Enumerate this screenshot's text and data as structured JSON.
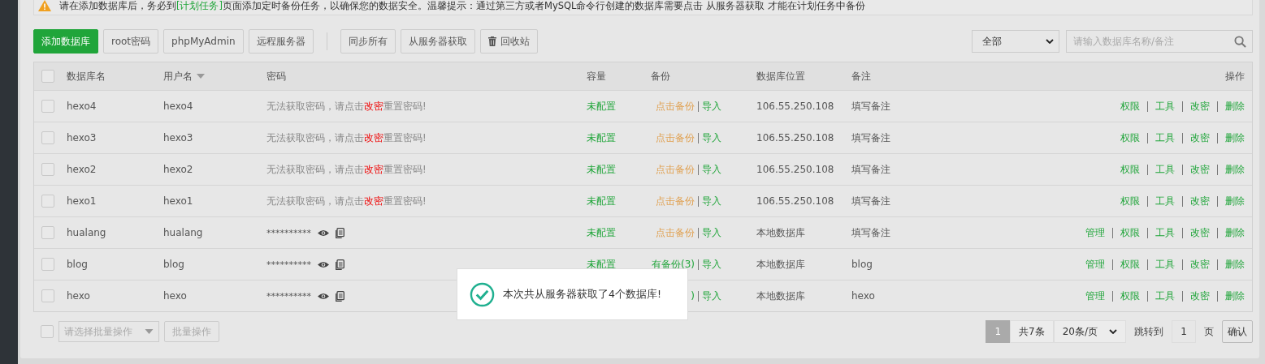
{
  "notice": {
    "before": "请在添加数据库后，务必到",
    "link": "[计划任务]",
    "after": "页面添加定时备份任务，以确保您的数据安全。温馨提示：通过第三方或者MySQL命令行创建的数据库需要点击 从服务器获取 才能在计划任务中备份"
  },
  "toolbar": {
    "buttons": [
      {
        "label": "添加数据库",
        "kind": "primary"
      },
      {
        "label": "root密码",
        "kind": "plain"
      },
      {
        "label": "phpMyAdmin",
        "kind": "plain"
      },
      {
        "label": "远程服务器",
        "kind": "plain"
      },
      {
        "label": "同步所有",
        "kind": "plain"
      },
      {
        "label": "从服务器获取",
        "kind": "plain"
      },
      {
        "label": "回收站",
        "kind": "trash"
      }
    ],
    "filter": {
      "value": "全部"
    },
    "search": {
      "placeholder": "请输入数据库名称/备注"
    }
  },
  "table": {
    "select_all": {
      "checked": false
    },
    "columns": [
      {
        "label": "数据库名",
        "sortable": false
      },
      {
        "label": "用户名",
        "sortable": true
      },
      {
        "label": "密码",
        "sortable": false
      },
      {
        "label": "容量",
        "sortable": false
      },
      {
        "label": "备份",
        "sortable": false
      },
      {
        "label": "数据库位置",
        "sortable": false
      },
      {
        "label": "备注",
        "sortable": false
      },
      {
        "label": "操作",
        "sortable": false
      }
    ],
    "rows": [
      {
        "checked": false,
        "name": "hexo4",
        "user": "hexo4",
        "password": {
          "kind": "hint",
          "before": "无法获取密码，请点击",
          "link": "改密",
          "after": "重置密码!"
        },
        "capacity": "未配置",
        "backup": {
          "kind": "none",
          "text": "点击备份"
        },
        "import": "导入",
        "location": "106.55.250.108",
        "note": "填写备注",
        "actions": [
          "权限",
          "工具",
          "改密",
          "删除"
        ]
      },
      {
        "checked": false,
        "name": "hexo3",
        "user": "hexo3",
        "password": {
          "kind": "hint",
          "before": "无法获取密码，请点击",
          "link": "改密",
          "after": "重置密码!"
        },
        "capacity": "未配置",
        "backup": {
          "kind": "none",
          "text": "点击备份"
        },
        "import": "导入",
        "location": "106.55.250.108",
        "note": "填写备注",
        "actions": [
          "权限",
          "工具",
          "改密",
          "删除"
        ]
      },
      {
        "checked": false,
        "name": "hexo2",
        "user": "hexo2",
        "password": {
          "kind": "hint",
          "before": "无法获取密码，请点击",
          "link": "改密",
          "after": "重置密码!"
        },
        "capacity": "未配置",
        "backup": {
          "kind": "none",
          "text": "点击备份"
        },
        "import": "导入",
        "location": "106.55.250.108",
        "note": "填写备注",
        "actions": [
          "权限",
          "工具",
          "改密",
          "删除"
        ]
      },
      {
        "checked": false,
        "name": "hexo1",
        "user": "hexo1",
        "password": {
          "kind": "hint",
          "before": "无法获取密码，请点击",
          "link": "改密",
          "after": "重置密码!"
        },
        "capacity": "未配置",
        "backup": {
          "kind": "none",
          "text": "点击备份"
        },
        "import": "导入",
        "location": "106.55.250.108",
        "note": "填写备注",
        "actions": [
          "权限",
          "工具",
          "改密",
          "删除"
        ]
      },
      {
        "checked": false,
        "name": "hualang",
        "user": "hualang",
        "password": {
          "kind": "masked",
          "text": "**********"
        },
        "capacity": "未配置",
        "backup": {
          "kind": "none",
          "text": "点击备份"
        },
        "import": "导入",
        "location": "本地数据库",
        "note": "填写备注",
        "actions": [
          "管理",
          "权限",
          "工具",
          "改密",
          "删除"
        ]
      },
      {
        "checked": false,
        "name": "blog",
        "user": "blog",
        "password": {
          "kind": "masked",
          "text": "**********"
        },
        "capacity": "未配置",
        "backup": {
          "kind": "has",
          "text": "有备份(3)"
        },
        "import": "导入",
        "location": "本地数据库",
        "note": "blog",
        "actions": [
          "管理",
          "权限",
          "工具",
          "改密",
          "删除"
        ]
      },
      {
        "checked": false,
        "name": "hexo",
        "user": "hexo",
        "password": {
          "kind": "masked",
          "text": "**********"
        },
        "backup": {
          "kind": "has",
          "text": ")"
        },
        "import": "导入",
        "location": "本地数据库",
        "note": "hexo",
        "actions": [
          "管理",
          "权限",
          "工具",
          "改密",
          "删除"
        ]
      }
    ]
  },
  "footer": {
    "select_all": {
      "checked": false
    },
    "batch_select": {
      "placeholder": "请选择批量操作"
    },
    "batch_button": "批量操作",
    "pagination": {
      "pages": [
        {
          "label": "1",
          "selected": true
        }
      ],
      "total": "共7条",
      "per_page": "20条/页",
      "jump_label": "跳转到",
      "jump_value": "1",
      "page_unit": "页",
      "confirm": "确认"
    }
  },
  "toast": {
    "message": "本次共从服务器获取了4个数据库!"
  }
}
